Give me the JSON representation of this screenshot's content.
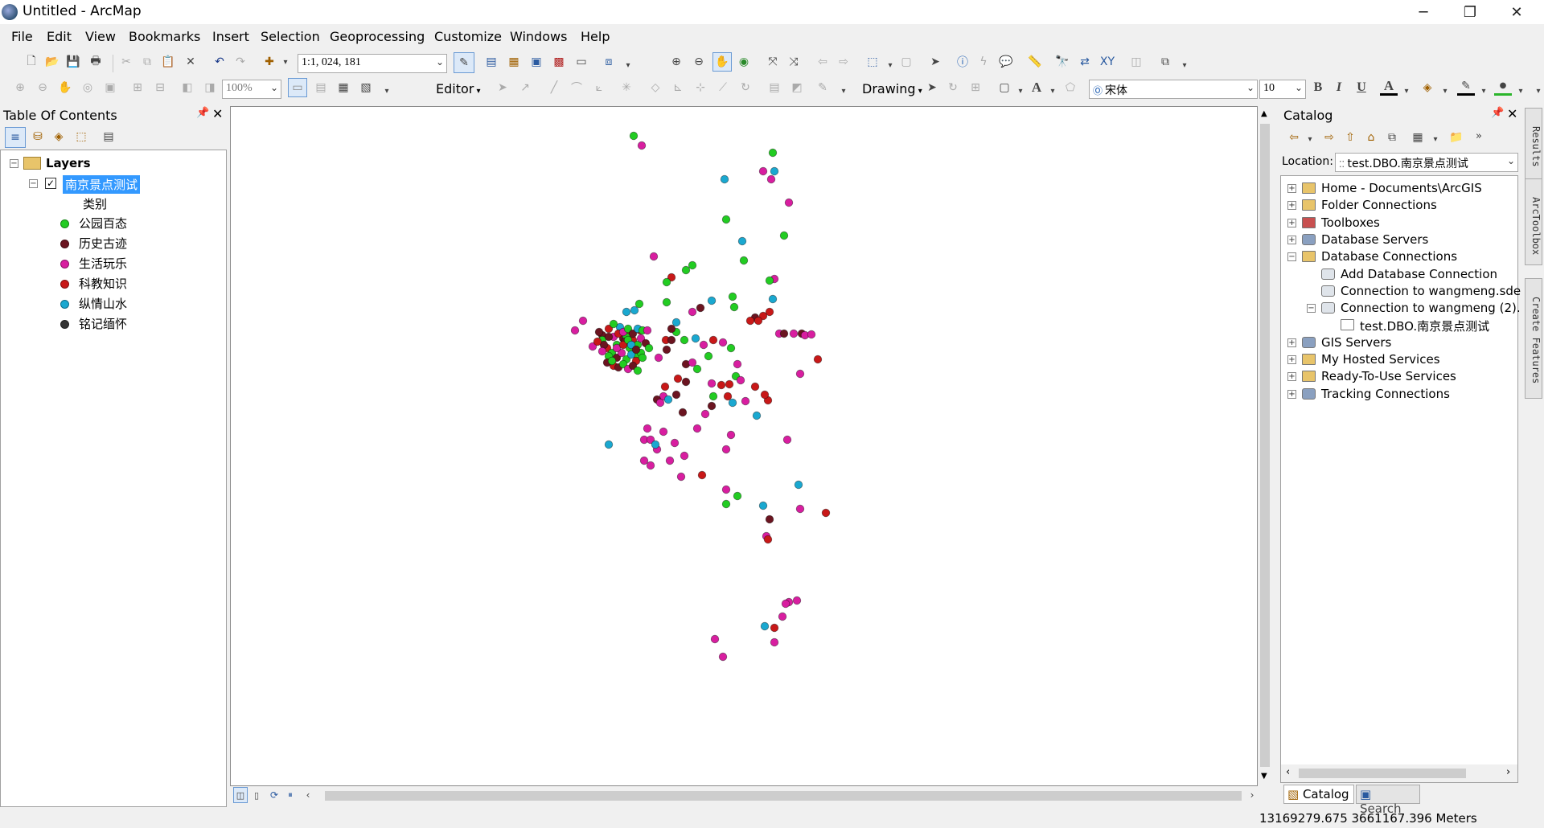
{
  "window": {
    "title": "Untitled - ArcMap",
    "minimize_glyph": "─",
    "restore_glyph": "❐",
    "close_glyph": "✕"
  },
  "menu": [
    "File",
    "Edit",
    "View",
    "Bookmarks",
    "Insert",
    "Selection",
    "Geoprocessing",
    "Customize",
    "Windows",
    "Help"
  ],
  "toolbar": {
    "scale": "1:1, 024, 181",
    "zoom_percent": "100%",
    "editor_label": "Editor",
    "drawing_label": "Drawing",
    "font_name": "宋体",
    "font_size": "10",
    "bold": "B",
    "italic": "I",
    "underline": "U",
    "text_tool": "A"
  },
  "toc": {
    "title": "Table Of Contents",
    "pin_glyph": "📌",
    "close_glyph": "✕",
    "root_label": "Layers",
    "layer_name": "南京景点测试",
    "field_label": "类别",
    "legend": [
      {
        "label": "公园百态",
        "color": "#22cc22"
      },
      {
        "label": "历史古迹",
        "color": "#6b1420"
      },
      {
        "label": "生活玩乐",
        "color": "#d81ea0"
      },
      {
        "label": "科教知识",
        "color": "#c81818"
      },
      {
        "label": "纵情山水",
        "color": "#1aa8d0"
      },
      {
        "label": "铭记缅怀",
        "color": "#333333"
      }
    ]
  },
  "catalog": {
    "title": "Catalog",
    "location_label": "Location:",
    "location_value": "test.DBO.南京景点测试",
    "tree": [
      {
        "label": "Home - Documents\\ArcGIS",
        "expander": "+",
        "indent": 0,
        "icon": "folder"
      },
      {
        "label": "Folder Connections",
        "expander": "+",
        "indent": 0,
        "icon": "folder"
      },
      {
        "label": "Toolboxes",
        "expander": "+",
        "indent": 0,
        "icon": "toolbox"
      },
      {
        "label": "Database Servers",
        "expander": "+",
        "indent": 0,
        "icon": "server"
      },
      {
        "label": "Database Connections",
        "expander": "−",
        "indent": 0,
        "icon": "folder"
      },
      {
        "label": "Add Database Connection",
        "expander": "",
        "indent": 1,
        "icon": "db"
      },
      {
        "label": "Connection to wangmeng.sde",
        "expander": "",
        "indent": 1,
        "icon": "db"
      },
      {
        "label": "Connection to wangmeng (2).",
        "expander": "−",
        "indent": 1,
        "icon": "db"
      },
      {
        "label": "test.DBO.南京景点测试",
        "expander": "",
        "indent": 2,
        "icon": "fc"
      },
      {
        "label": "GIS Servers",
        "expander": "+",
        "indent": 0,
        "icon": "server"
      },
      {
        "label": "My Hosted Services",
        "expander": "+",
        "indent": 0,
        "icon": "folder"
      },
      {
        "label": "Ready-To-Use Services",
        "expander": "+",
        "indent": 0,
        "icon": "folder"
      },
      {
        "label": "Tracking Connections",
        "expander": "+",
        "indent": 0,
        "icon": "server"
      }
    ],
    "tabs": [
      "Catalog",
      "Search"
    ]
  },
  "side_tabs": [
    "Results",
    "ArcToolbox",
    "Create Features"
  ],
  "status": {
    "coordinates": "13169279.675  3661167.396 Meters"
  },
  "colors": {
    "selection": "#3399ff",
    "panel_bg": "#f0f0f0"
  }
}
